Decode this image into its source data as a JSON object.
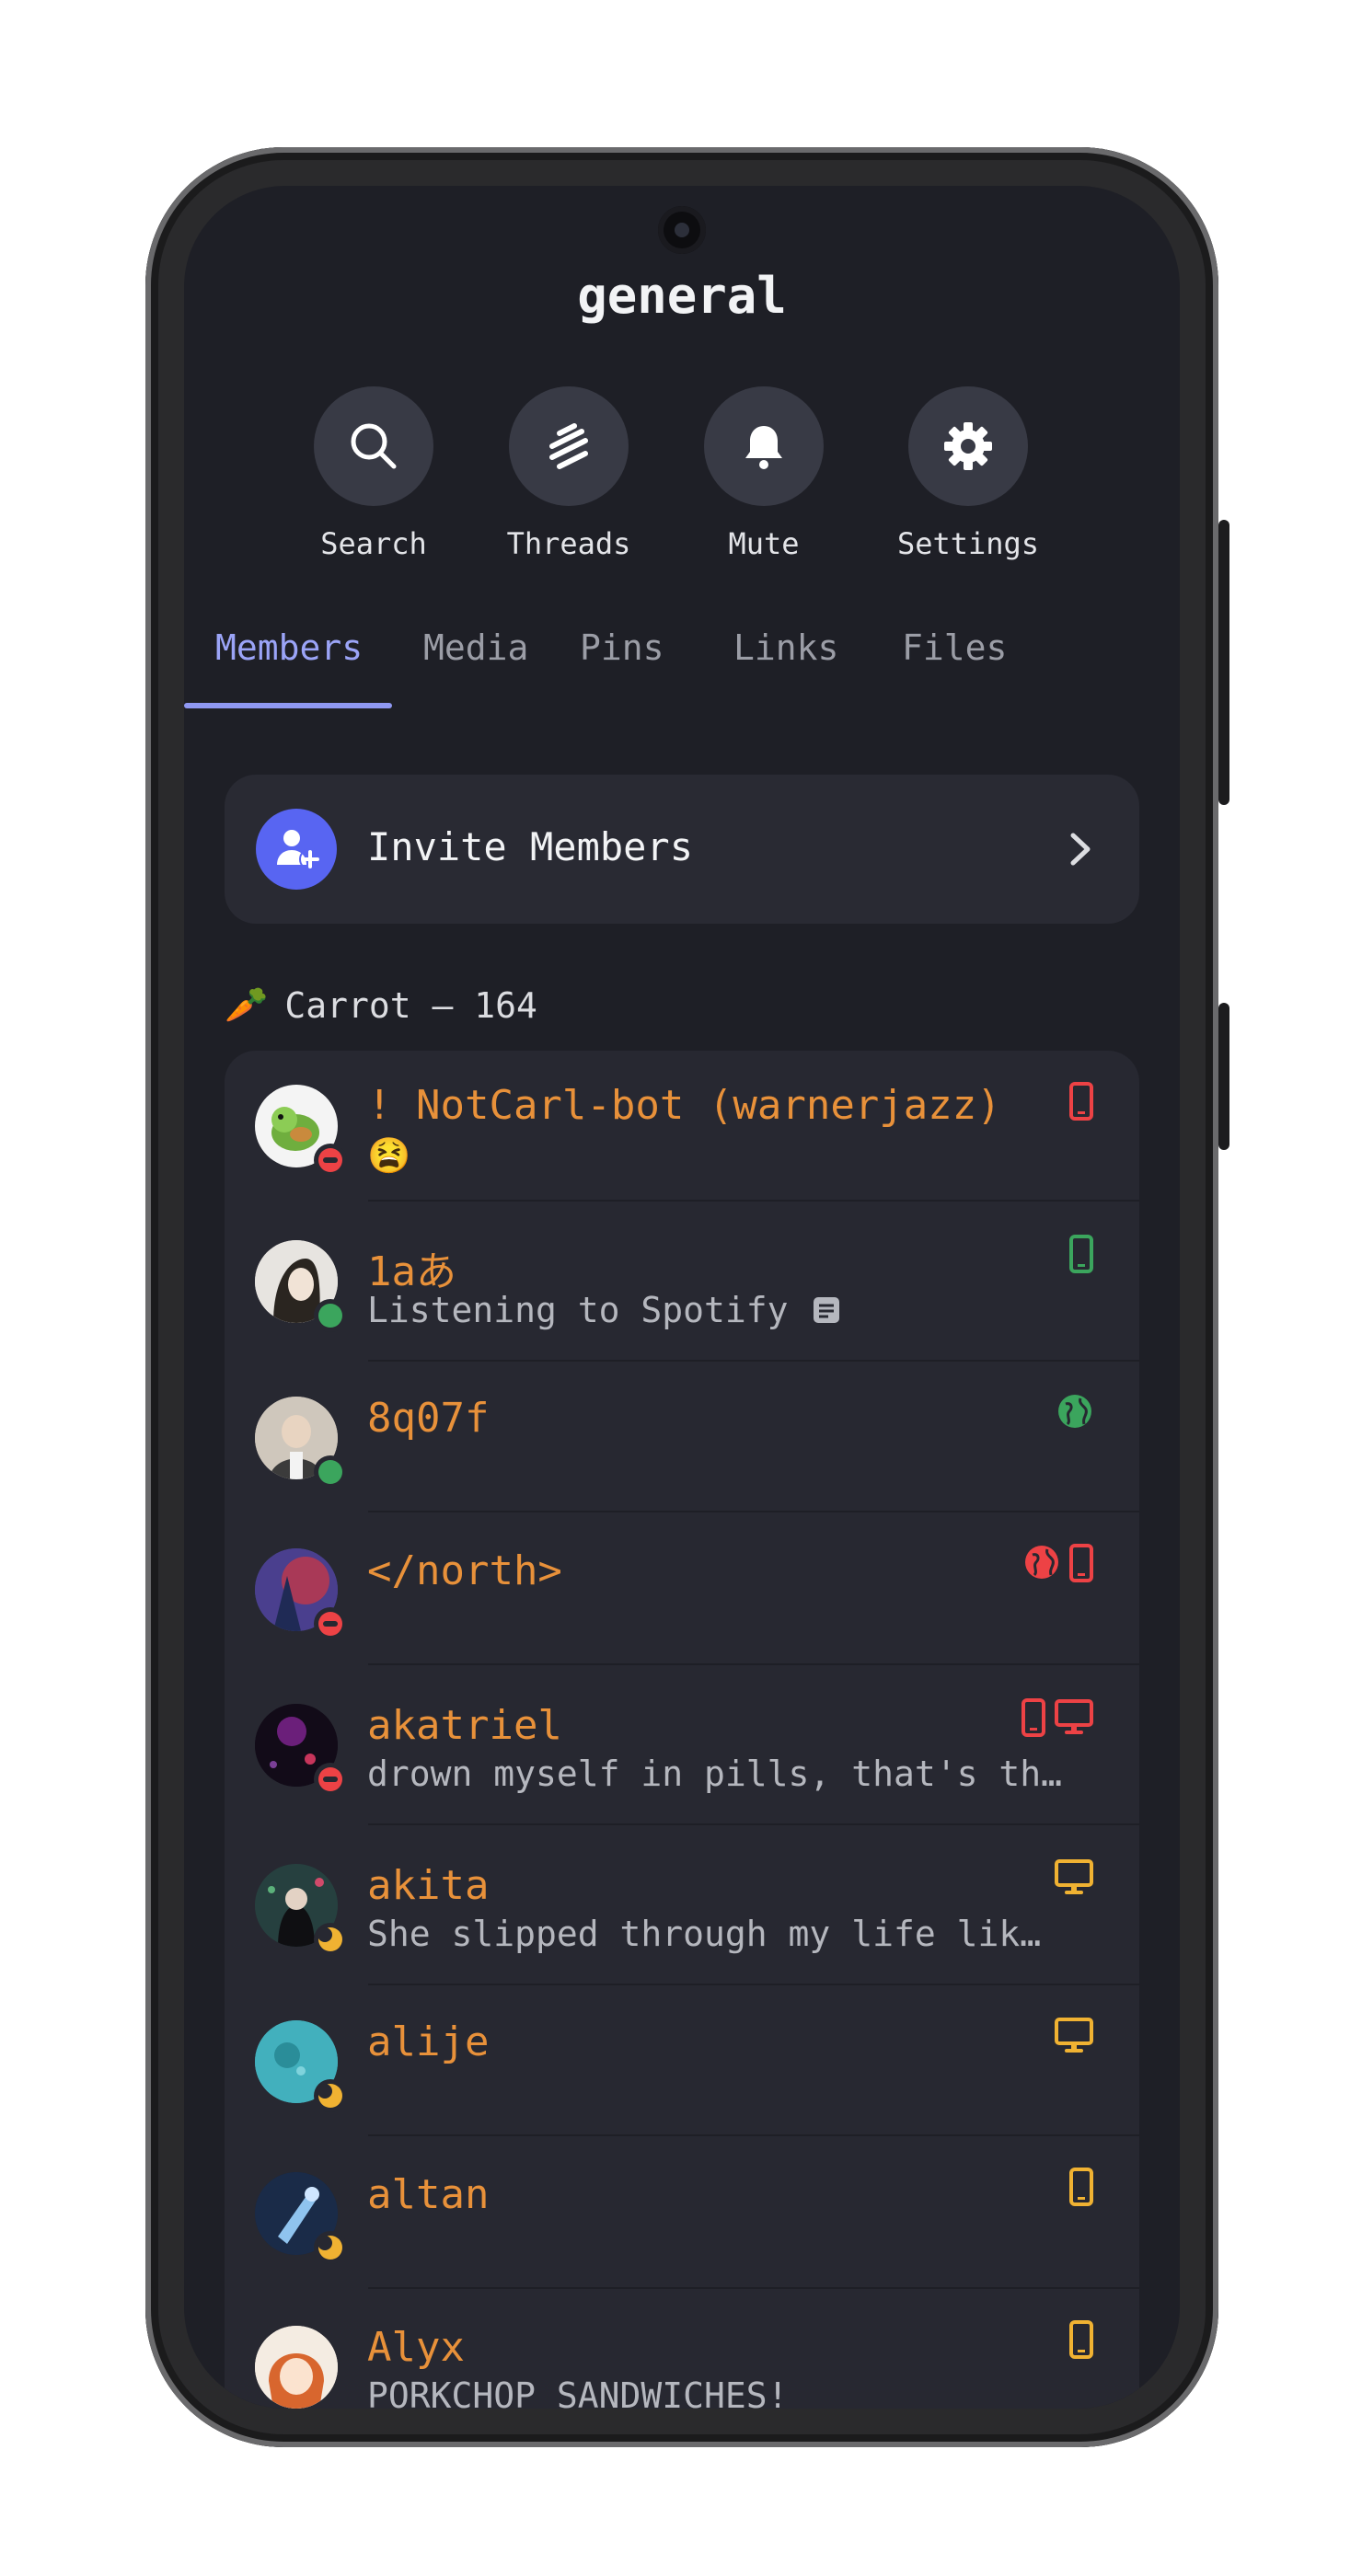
{
  "channel": {
    "title": "general"
  },
  "actions": [
    {
      "label": "Search",
      "icon": "search-icon"
    },
    {
      "label": "Threads",
      "icon": "threads-icon"
    },
    {
      "label": "Mute",
      "icon": "bell-icon"
    },
    {
      "label": "Settings",
      "icon": "gear-icon"
    }
  ],
  "tabs": [
    "Members",
    "Media",
    "Pins",
    "Links",
    "Files"
  ],
  "active_tab": "Members",
  "invite": {
    "label": "Invite Members",
    "icon": "add-user-icon"
  },
  "group": {
    "emoji": "🥕",
    "label": "Carrot — 164"
  },
  "members": [
    {
      "name": "! NotCarl-bot (warnerjazz)",
      "sub": "😫",
      "status": "dnd",
      "devices": [
        "mobile-icon"
      ],
      "device_color": "#ed4245"
    },
    {
      "name": "1aあ",
      "sub": "Listening to Spotify",
      "status": "online",
      "devices": [
        "mobile-icon"
      ],
      "device_color": "#3ba55d"
    },
    {
      "name": "8q07f",
      "sub": "",
      "status": "online",
      "devices": [
        "globe-icon"
      ],
      "device_color": "#3ba55d"
    },
    {
      "name": "</north>",
      "sub": "",
      "status": "dnd",
      "devices": [
        "globe-icon",
        "mobile-icon"
      ],
      "device_color": "#ed4245"
    },
    {
      "name": "akatriel",
      "sub": "drown myself in pills, that's th…",
      "status": "dnd",
      "devices": [
        "mobile-icon",
        "desktop-icon"
      ],
      "device_color": "#ed4245"
    },
    {
      "name": "akita",
      "sub": "She slipped through my life lik…",
      "status": "idle",
      "devices": [
        "desktop-icon"
      ],
      "device_color": "#f0b232"
    },
    {
      "name": "alije",
      "sub": "",
      "status": "idle",
      "devices": [
        "desktop-icon"
      ],
      "device_color": "#f0b232"
    },
    {
      "name": "altan",
      "sub": "",
      "status": "idle",
      "devices": [
        "mobile-icon"
      ],
      "device_color": "#f0b232"
    },
    {
      "name": "Alyx",
      "sub": "PORKCHOP SANDWICHES!",
      "status": "idle",
      "devices": [
        "mobile-icon"
      ],
      "device_color": "#f0b232"
    }
  ],
  "colors": {
    "accent": "#5865f2",
    "tab_active": "#9ba4f7",
    "username": "#e8913a",
    "background": "#1e1f26"
  }
}
